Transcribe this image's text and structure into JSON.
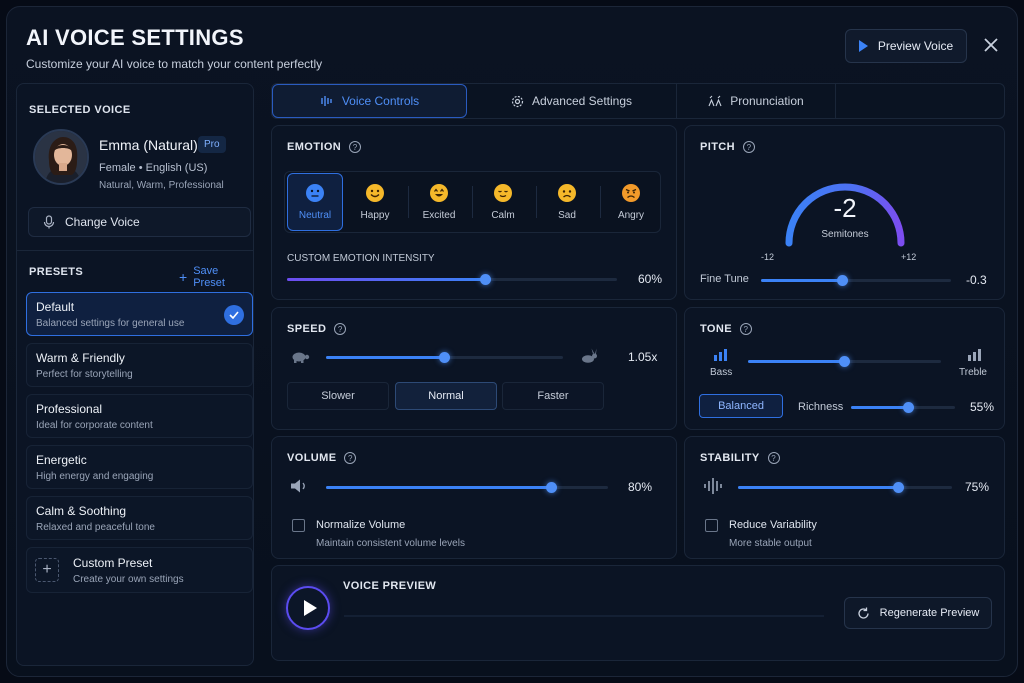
{
  "header": {
    "title": "AI VOICE SETTINGS",
    "subtitle": "Customize your AI voice to match your content perfectly",
    "preview_button": "Preview Voice"
  },
  "selected_voice": {
    "section_label": "SELECTED VOICE",
    "name": "Emma (Natural)",
    "badge": "Pro",
    "meta": "Female • English (US)",
    "tags": "Natural, Warm, Professional",
    "change_button": "Change Voice"
  },
  "presets": {
    "section_label": "PRESETS",
    "save_label": "Save Preset",
    "items": [
      {
        "title": "Default",
        "desc": "Balanced settings for general use",
        "active": true
      },
      {
        "title": "Warm & Friendly",
        "desc": "Perfect for storytelling"
      },
      {
        "title": "Professional",
        "desc": "Ideal for corporate content"
      },
      {
        "title": "Energetic",
        "desc": "High energy and engaging"
      },
      {
        "title": "Calm & Soothing",
        "desc": "Relaxed and peaceful tone"
      }
    ],
    "custom": {
      "title": "Custom Preset",
      "desc": "Create your own settings"
    }
  },
  "tabs": [
    {
      "label": "Voice Controls",
      "active": true
    },
    {
      "label": "Advanced Settings"
    },
    {
      "label": "Pronunciation"
    }
  ],
  "emotion": {
    "title": "EMOTION",
    "options": [
      "Neutral",
      "Happy",
      "Excited",
      "Calm",
      "Sad",
      "Angry"
    ],
    "selected": "Neutral",
    "intensity_label": "CUSTOM EMOTION INTENSITY",
    "intensity_value": "60%",
    "intensity_fraction": 0.6
  },
  "pitch": {
    "title": "PITCH",
    "value": "-2",
    "unit": "Semitones",
    "min_label": "-12",
    "max_label": "+12",
    "fine_tune_label": "Fine Tune",
    "fine_tune_value": "-0.3",
    "fine_tune_fraction": 0.43
  },
  "speed": {
    "title": "SPEED",
    "value": "1.05x",
    "fraction": 0.5,
    "buttons": [
      "Slower",
      "Normal",
      "Faster"
    ],
    "selected": "Normal"
  },
  "tone": {
    "title": "TONE",
    "bass_label": "Bass",
    "treble_label": "Treble",
    "fraction": 0.5,
    "balanced_label": "Balanced",
    "richness_label": "Richness",
    "richness_value": "55%",
    "richness_fraction": 0.55
  },
  "volume": {
    "title": "VOLUME",
    "value": "80%",
    "fraction": 0.8,
    "normalize_label": "Normalize Volume",
    "normalize_desc": "Maintain consistent volume levels"
  },
  "stability": {
    "title": "STABILITY",
    "value": "75%",
    "fraction": 0.75,
    "reduce_label": "Reduce Variability",
    "reduce_desc": "More stable output"
  },
  "preview": {
    "title": "VOICE PREVIEW",
    "regenerate_label": "Regenerate Preview"
  },
  "colors": {
    "accent": "#3b82f6",
    "accent_purple": "#6d4df0",
    "background": "#060b16",
    "panel": "#0b1424"
  }
}
